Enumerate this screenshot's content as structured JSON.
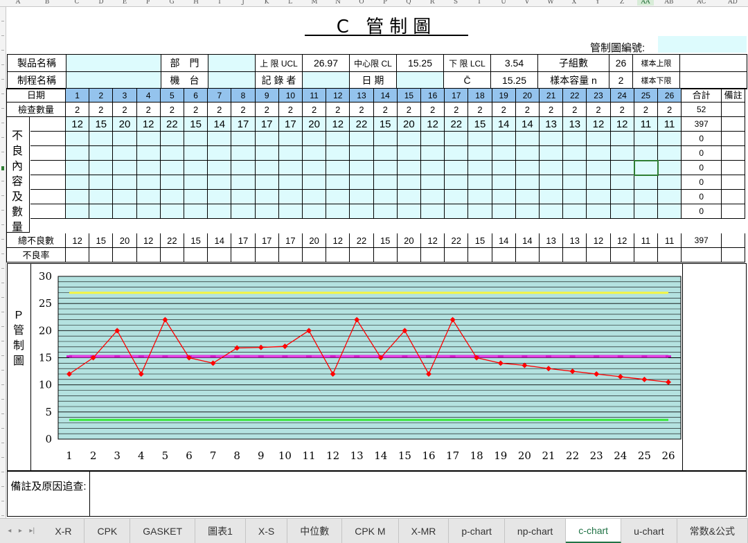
{
  "colors": {
    "cyan": "#ddfbfd",
    "blue": "#94c3ed",
    "ucl": "#f5f542",
    "cl": "#e23fe2",
    "lcl": "#3ae83a",
    "data": "#ff0000",
    "plot_bg": "#b4e2e0",
    "active_tab": "#217346"
  },
  "column_letters": [
    "A",
    "B",
    "C",
    "D",
    "E",
    "F",
    "G",
    "H",
    "I",
    "J",
    "K",
    "L",
    "M",
    "N",
    "O",
    "P",
    "Q",
    "R",
    "S",
    "T",
    "U",
    "V",
    "W",
    "X",
    "Y",
    "Z",
    "AA",
    "AB",
    "AC",
    "AD"
  ],
  "title": "C 管制圖",
  "control_no_label": "管制圖編號:",
  "header": {
    "product_label": "製品名稱",
    "dept_label": "部　門",
    "ucl_label": "上 限 UCL",
    "ucl_value": "26.97",
    "cl_label": "中心限 CL",
    "cl_value": "15.25",
    "lcl_label": "下 限 LCL",
    "lcl_value": "3.54",
    "subgroups_label": "子組數",
    "subgroups_value": "26",
    "sample_upper_label": "樣本上限",
    "process_label": "制程名稱",
    "machine_label": "機　台",
    "recorder_label": "記 錄 者",
    "date_label": "日 期",
    "cbar_label": "C̄",
    "cbar_value": "15.25",
    "sample_size_label": "樣本容量 n",
    "sample_size_value": "2",
    "sample_lower_label": "樣本下限"
  },
  "table": {
    "date_label": "日期",
    "inspect_label": "檢查數量",
    "defect_label_chars": [
      "不",
      "良",
      "內",
      "容",
      "及",
      "數",
      "量"
    ],
    "total_label": "總不良數",
    "rate_label": "不良率",
    "sum_label": "合計",
    "note_label": "備註",
    "days": [
      "1",
      "2",
      "3",
      "4",
      "5",
      "6",
      "7",
      "8",
      "9",
      "10",
      "11",
      "12",
      "13",
      "14",
      "15",
      "16",
      "17",
      "18",
      "19",
      "20",
      "21",
      "22",
      "23",
      "24",
      "25",
      "26"
    ],
    "inspect": [
      "2",
      "2",
      "2",
      "2",
      "2",
      "2",
      "2",
      "2",
      "2",
      "2",
      "2",
      "2",
      "2",
      "2",
      "2",
      "2",
      "2",
      "2",
      "2",
      "2",
      "2",
      "2",
      "2",
      "2",
      "2",
      "2"
    ],
    "inspect_sum": "52",
    "defect_row1": [
      "12",
      "15",
      "20",
      "12",
      "22",
      "15",
      "14",
      "17",
      "17",
      "17",
      "20",
      "12",
      "22",
      "15",
      "20",
      "12",
      "22",
      "15",
      "14",
      "14",
      "13",
      "13",
      "12",
      "12",
      "11",
      "11"
    ],
    "defect_row1_sum": "397",
    "defect_sums": [
      "0",
      "0",
      "0",
      "0",
      "0",
      "0"
    ],
    "totals": [
      "12",
      "15",
      "20",
      "12",
      "22",
      "15",
      "14",
      "17",
      "17",
      "17",
      "20",
      "12",
      "22",
      "15",
      "20",
      "12",
      "22",
      "15",
      "14",
      "14",
      "13",
      "13",
      "12",
      "12",
      "11",
      "11"
    ],
    "total_sum": "397"
  },
  "chart_label_chars": [
    "P",
    "管",
    "制",
    "圖"
  ],
  "chart_data": {
    "type": "line",
    "x": [
      1,
      2,
      3,
      4,
      5,
      6,
      7,
      8,
      9,
      10,
      11,
      12,
      13,
      14,
      15,
      16,
      17,
      18,
      19,
      20,
      21,
      22,
      23,
      24,
      25,
      26
    ],
    "series": [
      {
        "values": [
          12,
          15,
          20,
          12,
          22,
          15,
          14,
          16.8,
          16.9,
          17.1,
          20,
          12,
          22,
          15,
          20,
          12,
          22,
          15,
          14,
          13.6,
          13,
          12.5,
          12,
          11.5,
          11,
          10.5
        ],
        "color": "#ff0000"
      },
      {
        "values": [
          26.97,
          26.97,
          26.97,
          26.97,
          26.97,
          26.97,
          26.97,
          26.97,
          26.97,
          26.97,
          26.97,
          26.97,
          26.97,
          26.97,
          26.97,
          26.97,
          26.97,
          26.97,
          26.97,
          26.97,
          26.97,
          26.97,
          26.97,
          26.97,
          26.97,
          26.97
        ],
        "color": "#f5f542"
      },
      {
        "values": [
          15.25,
          15.25,
          15.25,
          15.25,
          15.25,
          15.25,
          15.25,
          15.25,
          15.25,
          15.25,
          15.25,
          15.25,
          15.25,
          15.25,
          15.25,
          15.25,
          15.25,
          15.25,
          15.25,
          15.25,
          15.25,
          15.25,
          15.25,
          15.25,
          15.25,
          15.25
        ],
        "color": "#e23fe2"
      },
      {
        "values": [
          3.54,
          3.54,
          3.54,
          3.54,
          3.54,
          3.54,
          3.54,
          3.54,
          3.54,
          3.54,
          3.54,
          3.54,
          3.54,
          3.54,
          3.54,
          3.54,
          3.54,
          3.54,
          3.54,
          3.54,
          3.54,
          3.54,
          3.54,
          3.54,
          3.54,
          3.54
        ],
        "color": "#3ae83a"
      }
    ],
    "yticks": [
      "0",
      "5",
      "10",
      "15",
      "20",
      "25",
      "30"
    ],
    "xticks": [
      "1",
      "2",
      "3",
      "4",
      "5",
      "6",
      "7",
      "8",
      "9",
      "10",
      "11",
      "12",
      "13",
      "14",
      "15",
      "16",
      "17",
      "18",
      "19",
      "20",
      "21",
      "22",
      "23",
      "24",
      "25",
      "26"
    ],
    "ylim": [
      0,
      30
    ],
    "grid": true,
    "legend": "none"
  },
  "remarks_label": "備註及原因追查:",
  "tabs": [
    {
      "label": "X-R",
      "active": false
    },
    {
      "label": "CPK",
      "active": false
    },
    {
      "label": "GASKET",
      "active": false
    },
    {
      "label": "圖表1",
      "active": false
    },
    {
      "label": "X-S",
      "active": false
    },
    {
      "label": "中位數",
      "active": false
    },
    {
      "label": "CPK M",
      "active": false
    },
    {
      "label": "X-MR",
      "active": false
    },
    {
      "label": "p-chart",
      "active": false
    },
    {
      "label": "np-chart",
      "active": false
    },
    {
      "label": "c-chart",
      "active": true
    },
    {
      "label": "u-chart",
      "active": false
    },
    {
      "label": "常数&公式",
      "active": false
    }
  ]
}
